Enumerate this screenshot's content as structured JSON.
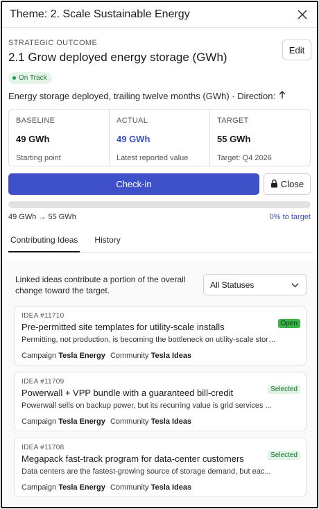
{
  "header": {
    "title": "Theme: 2. Scale Sustainable Energy",
    "close_icon": "close-icon"
  },
  "outcome": {
    "eyebrow": "STRATEGIC OUTCOME",
    "title": "2.1 Grow deployed energy storage (GWh)",
    "edit_label": "Edit",
    "status": "On Track",
    "metric": "Energy storage deployed, trailing twelve months (GWh) · Direction:",
    "direction_icon": "arrow-up-icon"
  },
  "stats": [
    {
      "label": "BASELINE",
      "value": "49 GWh",
      "sub": "Starting point"
    },
    {
      "label": "ACTUAL",
      "value": "49 GWh",
      "sub": "Latest reported value"
    },
    {
      "label": "TARGET",
      "value": "55 GWh",
      "sub": "Target: Q4 2026"
    }
  ],
  "actions": {
    "checkin_label": "Check-in",
    "close_label": "Close",
    "close_icon": "lock-icon"
  },
  "progress": {
    "percent": 0,
    "range": "49 GWh → 55 GWh",
    "pct_label": "0% to target"
  },
  "tabs": [
    {
      "label": "Contributing Ideas",
      "active": true
    },
    {
      "label": "History",
      "active": false
    }
  ],
  "ideas": {
    "intro": "Linked ideas contribute a portion of the overall change toward the target.",
    "filter_value": "All Statuses",
    "campaign_label": "Campaign",
    "community_label": "Community",
    "items": [
      {
        "id": "IDEA #11710",
        "title": "Pre-permitted site templates for utility-scale installs",
        "desc": "Permitting, not production, is becoming the bottleneck on utility-scale stora...",
        "campaign": "Tesla Energy",
        "community": "Tesla Ideas",
        "status": "Open"
      },
      {
        "id": "IDEA #11709",
        "title": "Powerwall + VPP bundle with a guaranteed bill-credit",
        "desc": "Powerwall sells on backup power, but its recurring value is grid services ...",
        "campaign": "Tesla Energy",
        "community": "Tesla Ideas",
        "status": "Selected"
      },
      {
        "id": "IDEA #11708",
        "title": "Megapack fast-track program for data-center customers",
        "desc": "Data centers are the fastest-growing source of storage demand, but eac...",
        "campaign": "Tesla Energy",
        "community": "Tesla Ideas",
        "status": "Selected"
      }
    ]
  },
  "colors": {
    "accent": "#3f51c8",
    "on_track": "#1f9b4a",
    "open": "#3bb24a",
    "selected": "#dff4e3"
  }
}
